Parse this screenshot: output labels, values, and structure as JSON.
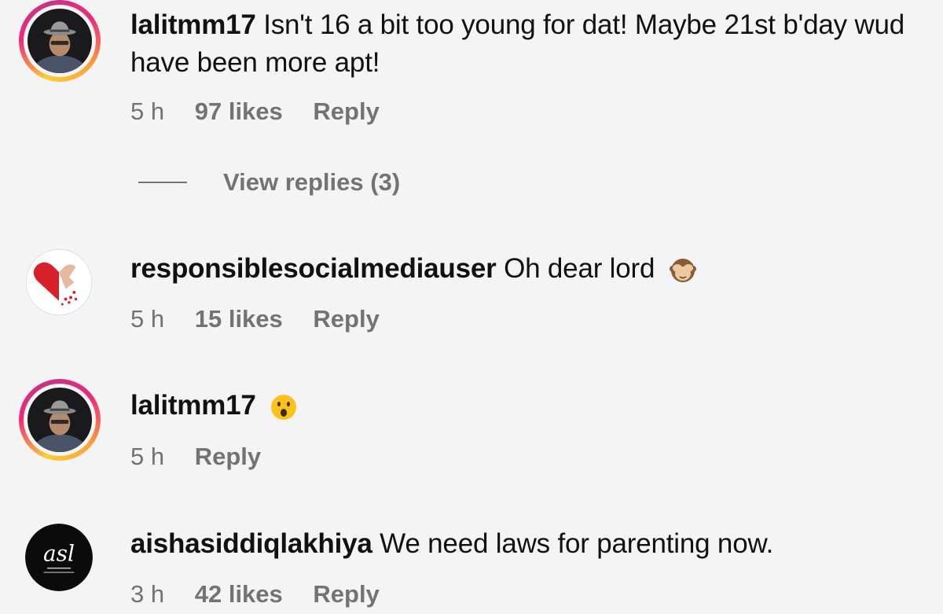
{
  "comments": [
    {
      "username": "lalitmm17",
      "text": "Isn't 16 a bit too young for dat! Maybe 21st b'day wud have been more apt!",
      "time": "5 h",
      "likes": "97 likes",
      "reply": "Reply",
      "view_replies": "View replies (3)"
    },
    {
      "username": "responsiblesocialmediauser",
      "text": "Oh dear lord",
      "emoji": "see-no-evil-monkey",
      "time": "5 h",
      "likes": "15 likes",
      "reply": "Reply"
    },
    {
      "username": "lalitmm17",
      "text": "",
      "emoji": "astonished-face",
      "time": "5 h",
      "reply": "Reply"
    },
    {
      "username": "aishasiddiqlakhiya",
      "text": "We need laws for parenting now.",
      "time": "3 h",
      "likes": "42 likes",
      "reply": "Reply",
      "avatar_text": "asl"
    }
  ],
  "colors": {
    "background": "#f4f4f4",
    "meta_text": "#737373",
    "story_ring_start": "#f9ce34",
    "story_ring_mid": "#ee2a7b"
  }
}
